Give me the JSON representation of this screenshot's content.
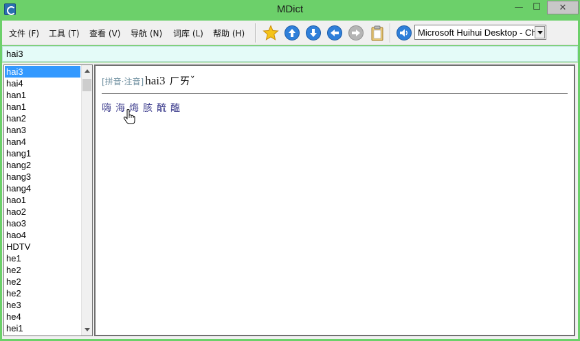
{
  "window": {
    "title": "MDict"
  },
  "menu": [
    "文件 (F)",
    "工具 (T)",
    "查看 (V)",
    "导航 (N)",
    "词库 (L)",
    "帮助 (H)"
  ],
  "toolbar": {
    "icons": [
      "star-icon",
      "arrow-up-icon",
      "arrow-down-icon",
      "arrow-left-icon",
      "arrow-right-icon",
      "clipboard-icon",
      "speaker-icon"
    ],
    "dictionary": "Microsoft Huihui Desktop - Chinese"
  },
  "search": {
    "value": "hai3"
  },
  "wordlist": {
    "selected_index": 0,
    "items": [
      "hai3",
      "hai4",
      "han1",
      "han1",
      "han2",
      "han3",
      "han4",
      "hang1",
      "hang2",
      "hang3",
      "hang4",
      "hao1",
      "hao2",
      "hao3",
      "hao4",
      "HDTV",
      "he1",
      "he2",
      "he2",
      "he2",
      "he3",
      "he4",
      "hei1"
    ]
  },
  "entry": {
    "tag": "[拼音·注音]",
    "headword": "hai3",
    "zhuyin": "ㄏㄞˇ",
    "characters": [
      "嗨",
      "海",
      "烸",
      "胲",
      "酼",
      "醢"
    ]
  },
  "colors": {
    "selection": "#3399ff",
    "search_bg": "#e4fbf8",
    "link": "#3b3b8c"
  }
}
